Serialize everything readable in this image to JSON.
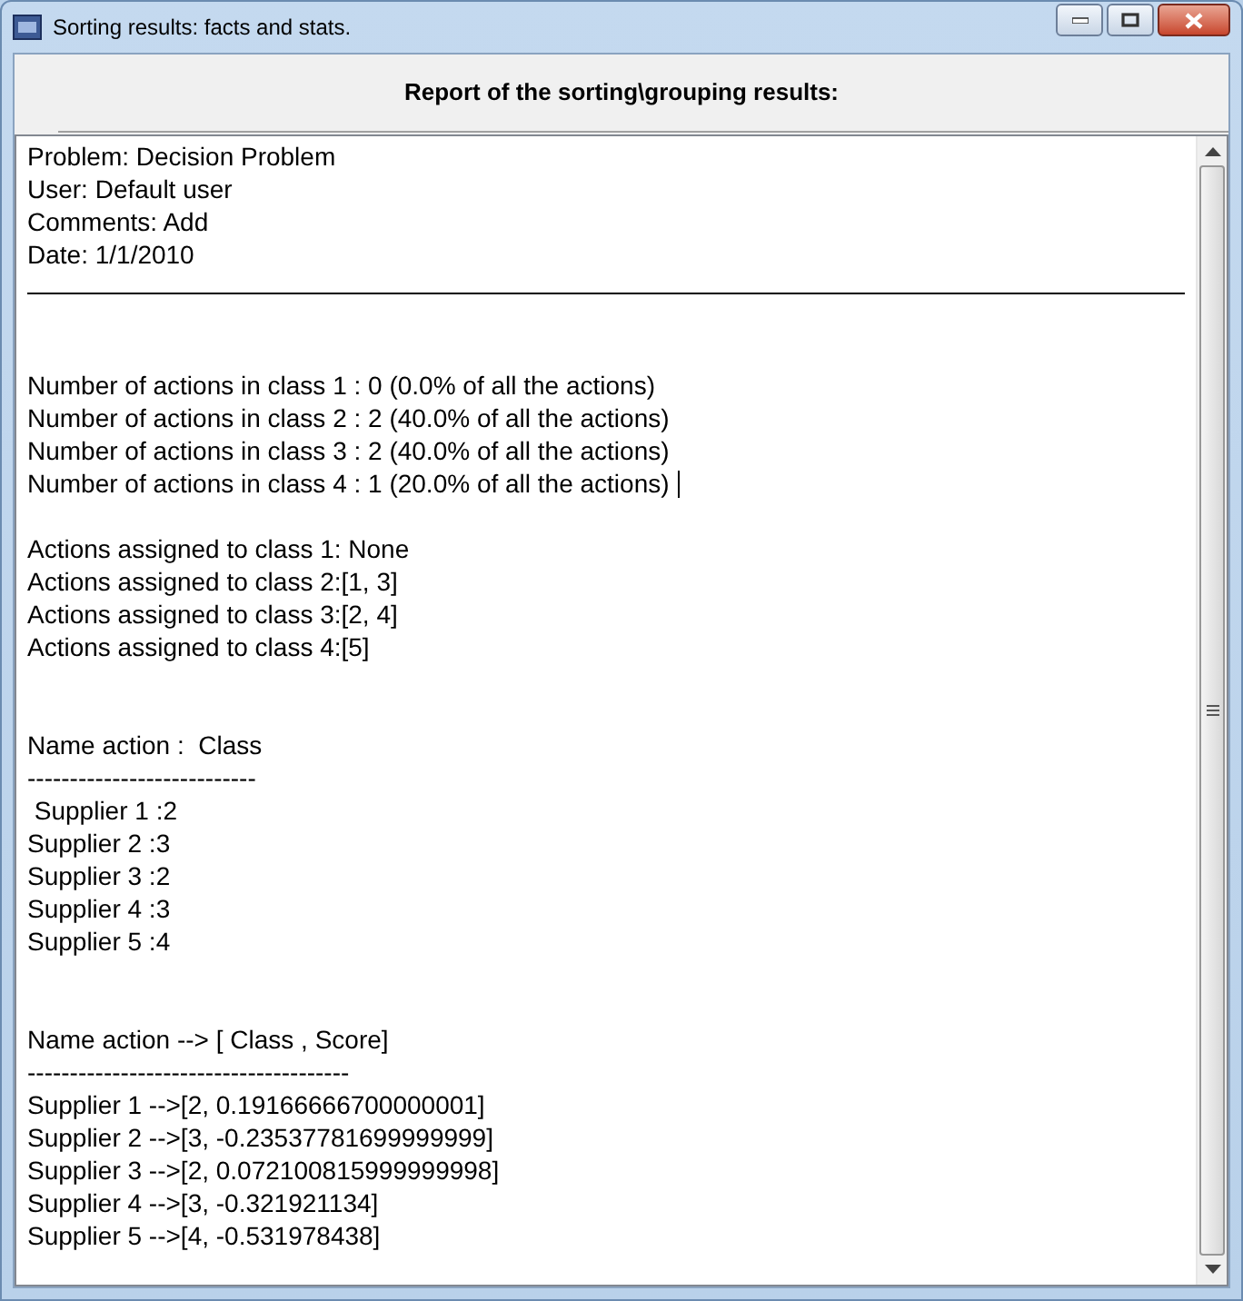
{
  "window": {
    "title": "Sorting results: facts and stats."
  },
  "report_title": "Report of the sorting\\grouping results:",
  "report": {
    "header": [
      "Problem: Decision Problem",
      "User: Default user",
      "Comments: Add",
      "Date: 1/1/2010"
    ],
    "class_counts": [
      "Number of actions in class 1 : 0 (0.0% of all the actions)",
      "Number of actions in class 2 : 2 (40.0% of all the actions)",
      "Number of actions in class 3 : 2 (40.0% of all the actions)",
      "Number of actions in class 4 : 1 (20.0% of all the actions)"
    ],
    "assignments": [
      "Actions assigned to class 1: None",
      "Actions assigned to class 2:[1, 3]",
      "Actions assigned to class 3:[2, 4]",
      "Actions assigned to class 4:[5]"
    ],
    "class_table": {
      "heading": "Name action :  Class",
      "separator": "---------------------------",
      "rows": [
        " Supplier 1 :2",
        "Supplier 2 :3",
        "Supplier 3 :2",
        "Supplier 4 :3",
        "Supplier 5 :4"
      ]
    },
    "score_table": {
      "heading": "Name action --> [ Class , Score]",
      "separator": "--------------------------------------",
      "rows": [
        "Supplier 1 -->[2, 0.19166666700000001]",
        "Supplier 2 -->[3, -0.23537781699999999]",
        "Supplier 3 -->[2, 0.072100815999999998]",
        "Supplier 4 -->[3, -0.321921134]",
        "Supplier 5 -->[4, -0.531978438]"
      ]
    }
  }
}
